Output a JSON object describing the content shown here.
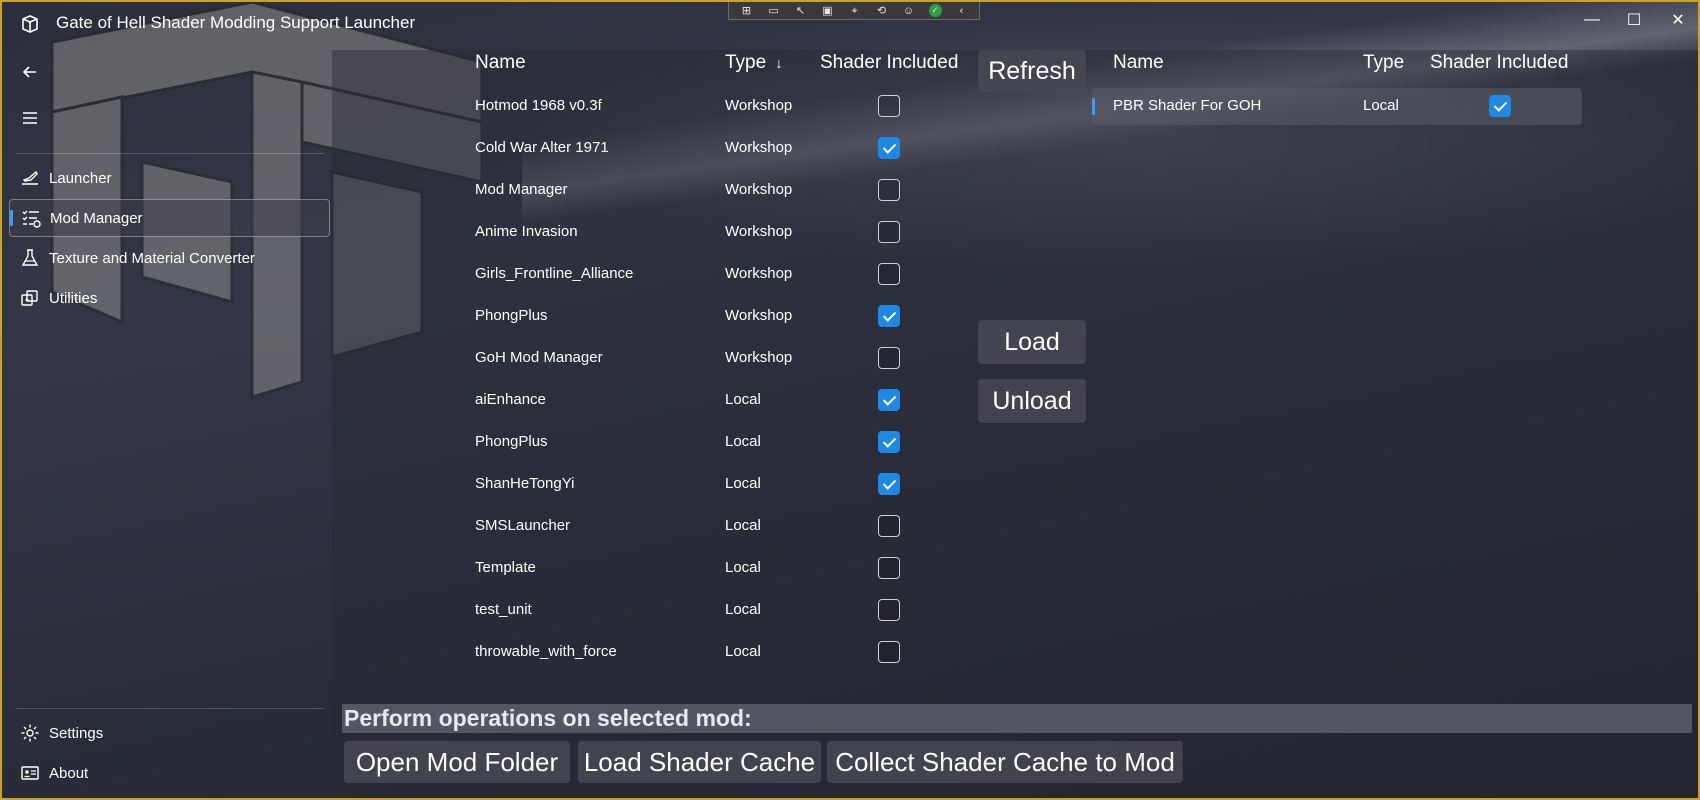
{
  "app": {
    "title": "Gate of Hell Shader Modding Support Launcher"
  },
  "window_controls": {
    "minimize_glyph": "—",
    "maximize_glyph": "☐",
    "close_glyph": "✕"
  },
  "sidebar": {
    "items": [
      {
        "label": "Launcher",
        "icon": "launcher-icon",
        "selected": false
      },
      {
        "label": "Mod Manager",
        "icon": "mod-manager-icon",
        "selected": true
      },
      {
        "label": "Texture and Material Converter",
        "icon": "converter-icon",
        "selected": false
      },
      {
        "label": "Utilities",
        "icon": "utilities-icon",
        "selected": false
      }
    ],
    "footer_items": [
      {
        "label": "Settings",
        "icon": "gear-icon"
      },
      {
        "label": "About",
        "icon": "about-icon"
      }
    ]
  },
  "mods_table": {
    "headers": {
      "name": "Name",
      "type": "Type",
      "shader": "Shader Included",
      "sort_glyph": "↓"
    },
    "rows": [
      {
        "name": "Hotmod 1968 v0.3f",
        "type": "Workshop",
        "shader_included": false
      },
      {
        "name": "Cold War Alter 1971",
        "type": "Workshop",
        "shader_included": true
      },
      {
        "name": "Mod Manager",
        "type": "Workshop",
        "shader_included": false
      },
      {
        "name": "Anime Invasion",
        "type": "Workshop",
        "shader_included": false
      },
      {
        "name": "Girls_Frontline_Alliance",
        "type": "Workshop",
        "shader_included": false
      },
      {
        "name": "PhongPlus",
        "type": "Workshop",
        "shader_included": true
      },
      {
        "name": "GoH Mod Manager",
        "type": "Workshop",
        "shader_included": false
      },
      {
        "name": "aiEnhance",
        "type": "Local",
        "shader_included": true
      },
      {
        "name": "PhongPlus",
        "type": "Local",
        "shader_included": true
      },
      {
        "name": "ShanHeTongYi",
        "type": "Local",
        "shader_included": true
      },
      {
        "name": "SMSLauncher",
        "type": "Local",
        "shader_included": false
      },
      {
        "name": "Template",
        "type": "Local",
        "shader_included": false
      },
      {
        "name": "test_unit",
        "type": "Local",
        "shader_included": false
      },
      {
        "name": "throwable_with_force",
        "type": "Local",
        "shader_included": false
      }
    ]
  },
  "actions": {
    "refresh": "Refresh",
    "load": "Load",
    "unload": "Unload"
  },
  "loaded_table": {
    "headers": {
      "name": "Name",
      "type": "Type",
      "shader": "Shader Included"
    },
    "rows": [
      {
        "name": "PBR Shader For GOH",
        "type": "Local",
        "shader_included": true
      }
    ]
  },
  "operations": {
    "title": "Perform operations on selected mod:",
    "open_folder": "Open Mod Folder",
    "load_cache": "Load Shader Cache",
    "collect_cache": "Collect Shader Cache to Mod"
  },
  "colors": {
    "accent": "#1e88e5",
    "indicator": "#3a9ff5",
    "window_border": "#c9a227"
  }
}
